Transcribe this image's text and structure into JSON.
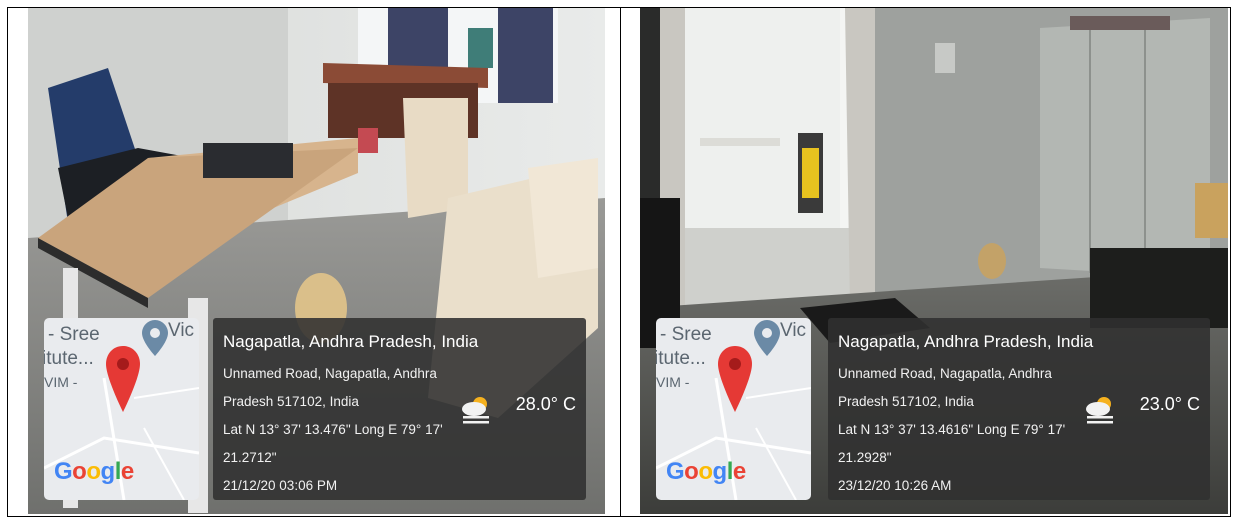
{
  "photos": [
    {
      "map": {
        "label_top": "- Sree",
        "label_mid": "itute...",
        "label_low": "VIM -",
        "label_right": "Vic",
        "logo": "Google"
      },
      "info": {
        "place": "Nagapatla, Andhra Pradesh, India",
        "address_line1": "Unnamed Road, Nagapatla, Andhra",
        "address_line2": "Pradesh 517102, India",
        "coords_line1": "Lat N 13° 37' 13.476\" Long E 79° 17'",
        "coords_line2": "21.2712\"",
        "datetime": "21/12/20 03:06 PM",
        "temperature": "28.0° C",
        "weather_icon": "partly-cloudy-icon"
      }
    },
    {
      "map": {
        "label_top": "- Sree",
        "label_mid": "itute...",
        "label_low": "VIM -",
        "label_right": "Vic",
        "logo": "Google"
      },
      "info": {
        "place": "Nagapatla, Andhra Pradesh, India",
        "address_line1": "Unnamed Road, Nagapatla, Andhra",
        "address_line2": "Pradesh 517102, India",
        "coords_line1": "Lat N 13° 37' 13.4616\" Long E 79° 17'",
        "coords_line2": "21.2928\"",
        "datetime": "23/12/20 10:26 AM",
        "temperature": "23.0° C",
        "weather_icon": "partly-cloudy-icon"
      }
    }
  ],
  "colors": {
    "pin": "#e53935",
    "overlay": "#303030",
    "map_bg": "#e9ebee"
  }
}
